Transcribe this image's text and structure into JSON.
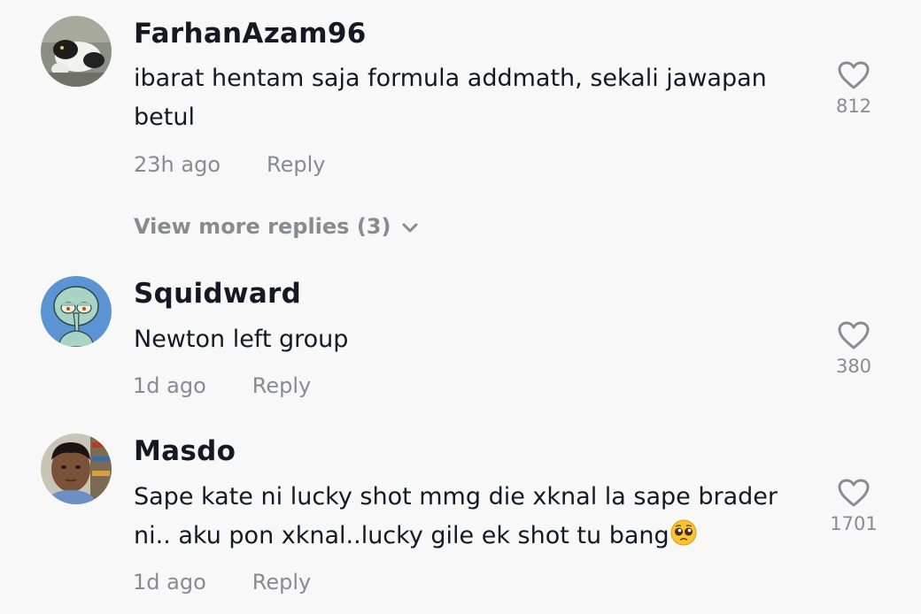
{
  "comments": [
    {
      "username": "FarhanAzam96",
      "text_line1": "ibarat hentam saja formula addmath, sekali jawapan",
      "text_line2": "betul",
      "time": "23h ago",
      "reply_label": "Reply",
      "likes": "812",
      "avatar_icon": "cat-avatar"
    },
    {
      "username": "Squidward",
      "text_line1": "Newton left group",
      "time": "1d ago",
      "reply_label": "Reply",
      "likes": "380",
      "avatar_icon": "squidward-avatar"
    },
    {
      "username": "Masdo",
      "text_line1": "Sape kate ni lucky shot mmg die xknal la sape brader",
      "text_line2": "ni.. aku pon xknal..lucky gile ek shot tu bang",
      "emoji": "pleading-face-emoji",
      "time": "1d ago",
      "reply_label": "Reply",
      "likes": "1701",
      "avatar_icon": "person-avatar"
    }
  ],
  "view_more_replies": "View more replies (3)",
  "colors": {
    "background": "#f8f8f8",
    "primary_text": "#161823",
    "secondary_text": "#8a8b91"
  }
}
